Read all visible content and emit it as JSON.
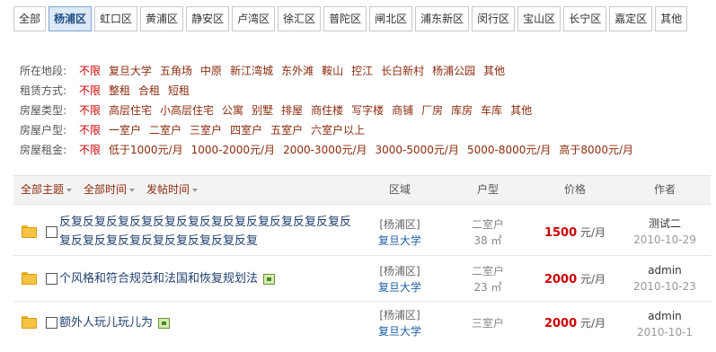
{
  "districts": [
    {
      "label": "全部",
      "active": false
    },
    {
      "label": "杨浦区",
      "active": true
    },
    {
      "label": "虹口区",
      "active": false
    },
    {
      "label": "黄浦区",
      "active": false
    },
    {
      "label": "静安区",
      "active": false
    },
    {
      "label": "卢湾区",
      "active": false
    },
    {
      "label": "徐汇区",
      "active": false
    },
    {
      "label": "普陀区",
      "active": false
    },
    {
      "label": "闸北区",
      "active": false
    },
    {
      "label": "浦东新区",
      "active": false
    },
    {
      "label": "闵行区",
      "active": false
    },
    {
      "label": "宝山区",
      "active": false
    },
    {
      "label": "长宁区",
      "active": false
    },
    {
      "label": "嘉定区",
      "active": false
    },
    {
      "label": "其他",
      "active": false
    }
  ],
  "filters": [
    {
      "label": "所在地段:",
      "options": [
        "不限",
        "复旦大学",
        "五角场",
        "中原",
        "新江湾城",
        "东外滩",
        "鞍山",
        "控江",
        "长白新村",
        "杨浦公园",
        "其他"
      ]
    },
    {
      "label": "租赁方式:",
      "options": [
        "不限",
        "整租",
        "合租",
        "短租"
      ]
    },
    {
      "label": "房屋类型:",
      "options": [
        "不限",
        "高层住宅",
        "小高层住宅",
        "公寓",
        "别墅",
        "排屋",
        "商住楼",
        "写字楼",
        "商铺",
        "厂房",
        "库房",
        "车库",
        "其他"
      ]
    },
    {
      "label": "房屋户型:",
      "options": [
        "不限",
        "一室户",
        "二室户",
        "三室户",
        "四室户",
        "五室户",
        "六室户以上"
      ]
    },
    {
      "label": "房屋租金:",
      "options": [
        "不限",
        "低于1000元/月",
        "1000-2000元/月",
        "2000-3000元/月",
        "3000-5000元/月",
        "5000-8000元/月",
        "高于8000元/月"
      ]
    }
  ],
  "list_header": {
    "sort_topic": "全部主题",
    "sort_time": "全部时间",
    "sort_post": "发帖时间",
    "col_area": "区域",
    "col_type": "户型",
    "col_price": "价格",
    "col_author": "作者"
  },
  "rows": [
    {
      "title": "反复反复反复反复反复反复反复反复反复反复反复反复反复反复反复反复反复反复反复反复反复",
      "has_image": false,
      "district": "[杨浦区]",
      "location": "复旦大学",
      "room_type": "二室户",
      "size": "38 ㎡",
      "price": "1500",
      "price_unit": "元/月",
      "author": "测试二",
      "date": "2010-10-29"
    },
    {
      "title": "个风格和符合规范和法国和恢复规划法",
      "has_image": true,
      "district": "[杨浦区]",
      "location": "复旦大学",
      "room_type": "二室户",
      "size": "23 ㎡",
      "price": "2000",
      "price_unit": "元/月",
      "author": "admin",
      "date": "2010-10-23"
    },
    {
      "title": "额外人玩儿玩儿为",
      "has_image": true,
      "district": "[杨浦区]",
      "location": "复旦大学",
      "room_type": "三室户",
      "size": "",
      "price": "2000",
      "price_unit": "元/月",
      "author": "admin",
      "date": "2010-10-1"
    }
  ]
}
